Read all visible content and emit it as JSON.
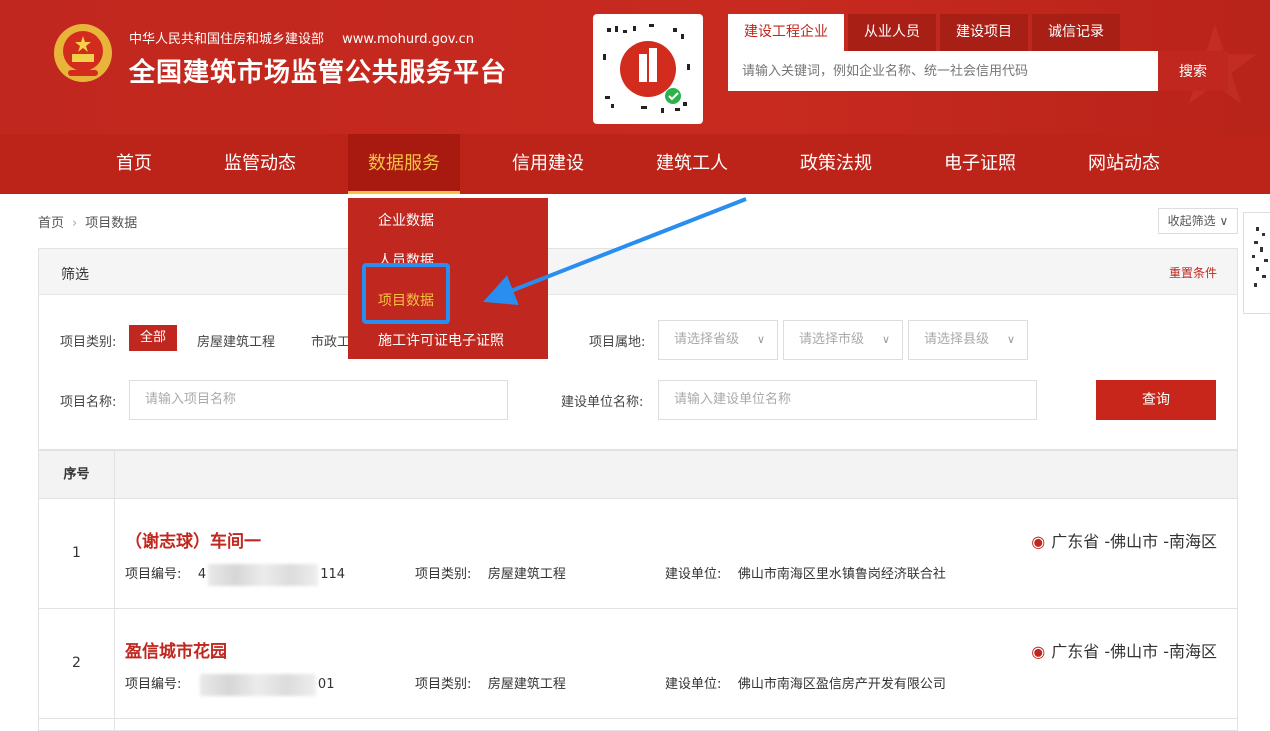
{
  "header": {
    "ministry": "中华人民共和国住房和城乡建设部",
    "url": "www.mohurd.gov.cn",
    "platform": "全国建筑市场监管公共服务平台",
    "search_tabs": [
      "建设工程企业",
      "从业人员",
      "建设项目",
      "诚信记录"
    ],
    "search_placeholder": "请输入关键词，例如企业名称、统一社会信用代码",
    "search_button": "搜索"
  },
  "nav": {
    "items": [
      "首页",
      "监管动态",
      "数据服务",
      "信用建设",
      "建筑工人",
      "政策法规",
      "电子证照",
      "网站动态"
    ],
    "active": "数据服务"
  },
  "dropdown": {
    "items": [
      "企业数据",
      "人员数据",
      "项目数据",
      "施工许可证电子证照"
    ],
    "highlighted": "项目数据"
  },
  "breadcrumb": {
    "home": "首页",
    "current": "项目数据"
  },
  "collapse_label": "收起筛选",
  "filter": {
    "title": "筛选",
    "reset": "重置条件",
    "category_label": "项目类别:",
    "categories": [
      "全部",
      "房屋建筑工程",
      "市政工"
    ],
    "location_label": "项目属地:",
    "province_placeholder": "请选择省级",
    "city_placeholder": "请选择市级",
    "county_placeholder": "请选择县级",
    "name_label": "项目名称:",
    "name_placeholder": "请输入项目名称",
    "builder_label": "建设单位名称:",
    "builder_placeholder": "请输入建设单位名称",
    "query_button": "查询"
  },
  "table": {
    "header_index": "序号",
    "rows": [
      {
        "index": "1",
        "name": "（谢志球）车间一",
        "location": "广东省 -佛山市 -南海区",
        "code_label": "项目编号:",
        "code_prefix": "4",
        "code_suffix": "114",
        "type_label": "项目类别:",
        "type": "房屋建筑工程",
        "unit_label": "建设单位:",
        "unit": "佛山市南海区里水镇鲁岗经济联合社"
      },
      {
        "index": "2",
        "name": "盈信城市花园",
        "location": "广东省 -佛山市 -南海区",
        "code_label": "项目编号:",
        "code_prefix": "",
        "code_suffix": "01",
        "type_label": "项目类别:",
        "type": "房屋建筑工程",
        "unit_label": "建设单位:",
        "unit": "佛山市南海区盈信房产开发有限公司"
      }
    ]
  },
  "colors": {
    "brand_red": "#c0271e",
    "nav_active_text": "#f5c242",
    "annotation_blue": "#2a8ef0"
  }
}
